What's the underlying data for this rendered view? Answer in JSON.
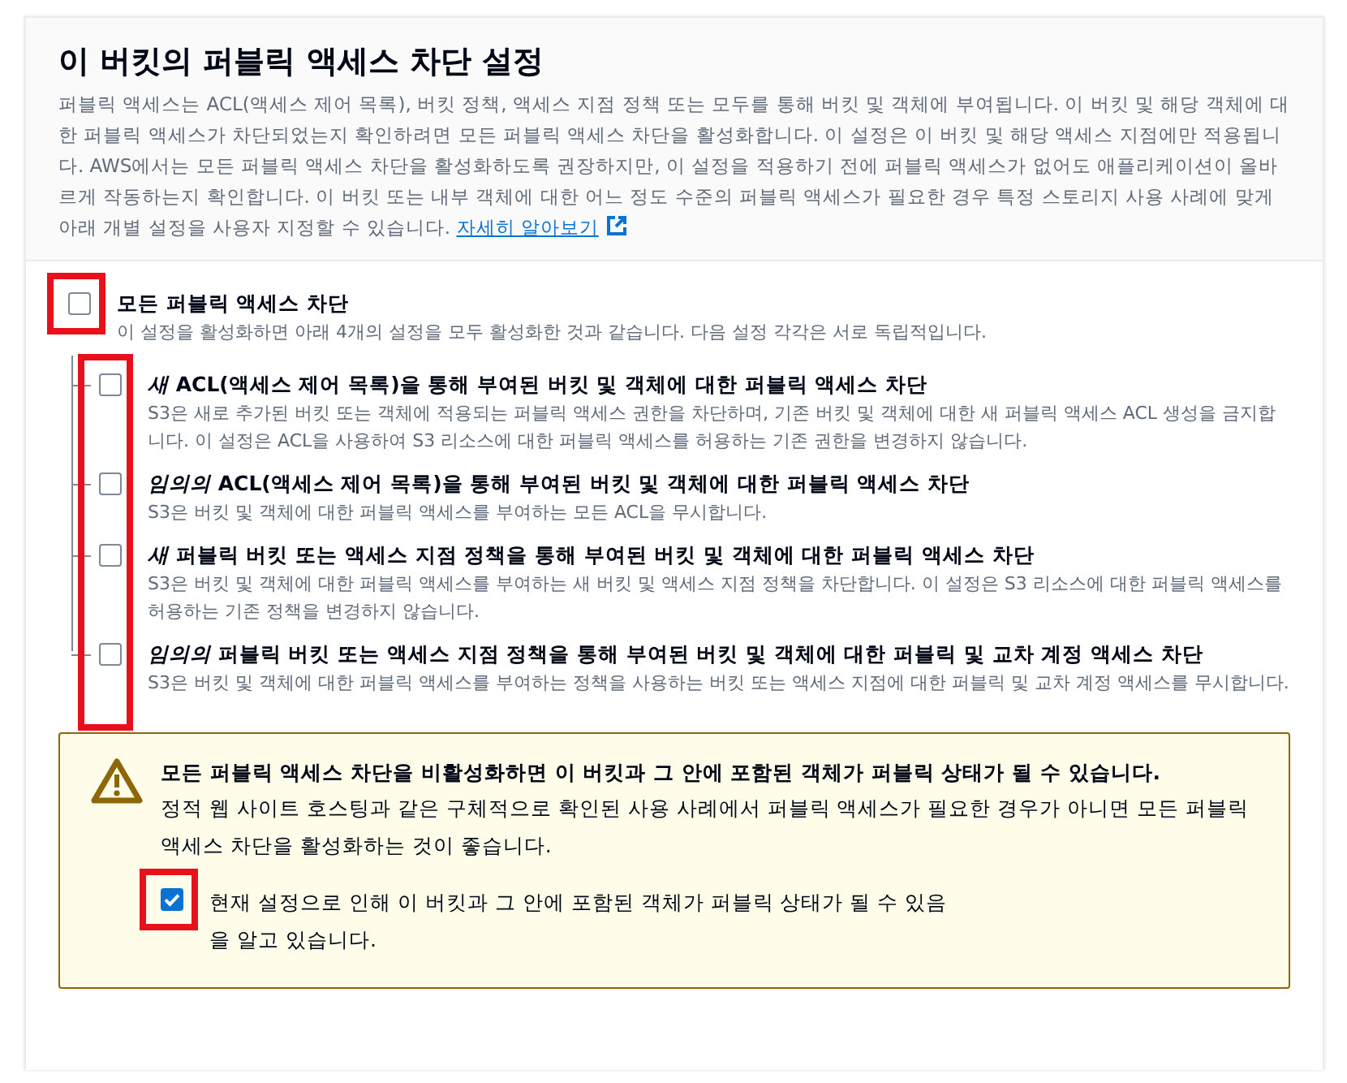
{
  "panel": {
    "title": "이 버킷의 퍼블릭 액세스 차단 설정",
    "description": "퍼블릭 액세스는 ACL(액세스 제어 목록), 버킷 정책, 액세스 지점 정책 또는 모두를 통해 버킷 및 객체에 부여됩니다. 이 버킷 및 해당 객체에 대한 퍼블릭 액세스가 차단되었는지 확인하려면 모든 퍼블릭 액세스 차단을 활성화합니다. 이 설정은 이 버킷 및 해당 액세스 지점에만 적용됩니다. AWS에서는 모든 퍼블릭 액세스 차단을 활성화하도록 권장하지만, 이 설정을 적용하기 전에 퍼블릭 액세스가 없어도 애플리케이션이 올바르게 작동하는지 확인합니다. 이 버킷 또는 내부 객체에 대한 어느 정도 수준의 퍼블릭 액세스가 필요한 경우 특정 스토리지 사용 사례에 맞게 아래 개별 설정을 사용자 지정할 수 있습니다.",
    "link": "자세히 알아보기"
  },
  "block_all": {
    "label": "모든 퍼블릭 액세스 차단",
    "description": "이 설정을 활성화하면 아래 4개의 설정을 모두 활성화한 것과 같습니다. 다음 설정 각각은 서로 독립적입니다.",
    "checked": false,
    "highlighted": true
  },
  "options_highlighted": true,
  "options": [
    {
      "label": "*새* ACL(액세스 제어 목록)을 통해 부여된 버킷 및 객체에 대한 퍼블릭 액세스 차단",
      "description": "S3은 새로 추가된 버킷 또는 객체에 적용되는 퍼블릭 액세스 권한을 차단하며, 기존 버킷 및 객체에 대한 새 퍼블릭 액세스 ACL 생성을 금지합니다. 이 설정은 ACL을 사용하여 S3 리소스에 대한 퍼블릭 액세스를 허용하는 기존 권한을 변경하지 않습니다.",
      "checked": false
    },
    {
      "label": "*임의의* ACL(액세스 제어 목록)을 통해 부여된 버킷 및 객체에 대한 퍼블릭 액세스 차단",
      "description": "S3은 버킷 및 객체에 대한 퍼블릭 액세스를 부여하는 모든 ACL을 무시합니다.",
      "checked": false
    },
    {
      "label": "*새* 퍼블릭 버킷 또는 액세스 지점 정책을 통해 부여된 버킷 및 객체에 대한 퍼블릭 액세스 차단",
      "description": "S3은 버킷 및 객체에 대한 퍼블릭 액세스를 부여하는 새 버킷 및 액세스 지점 정책을 차단합니다. 이 설정은 S3 리소스에 대한 퍼블릭 액세스를 허용하는 기존 정책을 변경하지 않습니다.",
      "checked": false
    },
    {
      "label": "*임의의* 퍼블릭 버킷 또는 액세스 지점 정책을 통해 부여된 버킷 및 객체에 대한 퍼블릭 및 교차 계정 액세스 차단",
      "description": "S3은 버킷 및 객체에 대한 퍼블릭 액세스를 부여하는 정책을 사용하는 버킷 또는 액세스 지점에 대한 퍼블릭 및 교차 계정 액세스를 무시합니다.",
      "checked": false
    }
  ],
  "warning": {
    "title": "모든 퍼블릭 액세스 차단을 비활성화하면 이 버킷과 그 안에 포함된 객체가 퍼블릭 상태가 될 수 있습니다.",
    "text": "정적 웹 사이트 호스팅과 같은 구체적으로 확인된 사용 사례에서 퍼블릭 액세스가 필요한 경우가 아니면 모든 퍼블릭 액세스 차단을 활성화하는 것이 좋습니다.",
    "acknowledgement": {
      "label": "현재 설정으로 인해 이 버킷과 그 안에 포함된 객체가 퍼블릭 상태가 될 수 있음을 알고 있습니다.",
      "checked": true,
      "highlighted": true
    }
  }
}
